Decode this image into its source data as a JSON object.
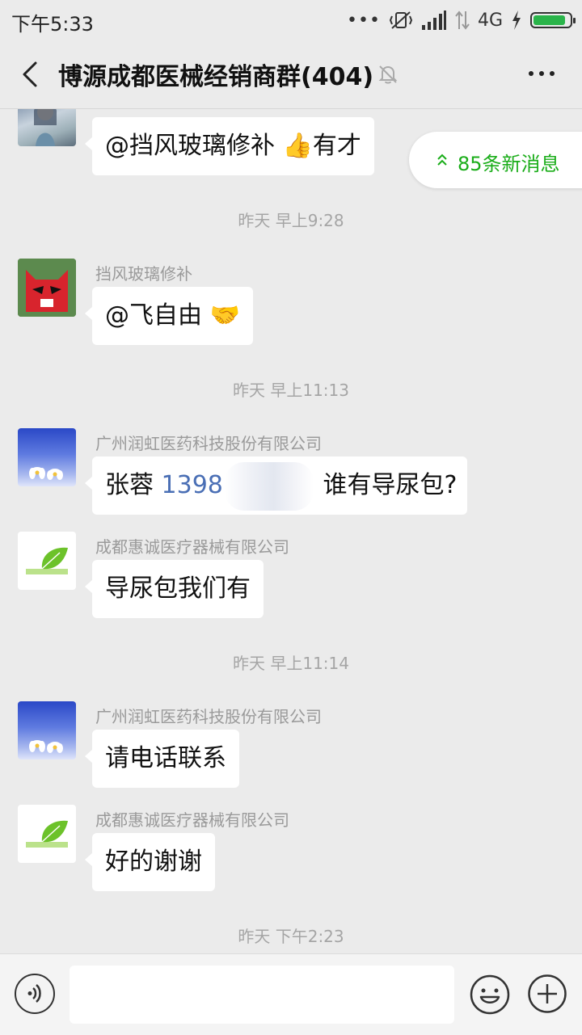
{
  "status_bar": {
    "time": "下午5:33",
    "dots": "•••",
    "network": "4G",
    "battery_level": 0.9
  },
  "header": {
    "title": "博源成都医械经销商群(404)",
    "back_icon": "chevron-left-icon",
    "mute_icon": "bell-muted-icon",
    "more_icon": "more-dots-icon"
  },
  "new_messages": {
    "label": "85条新消息",
    "icon": "double-chevron-up-icon"
  },
  "messages": [
    {
      "text": "@挡风玻璃修补 👍有才"
    },
    {
      "timestamp": "昨天 早上9:28"
    },
    {
      "sender": "挡风玻璃修补",
      "text": "@飞自由 🤝"
    },
    {
      "timestamp": "昨天 早上11:13"
    },
    {
      "sender": "广州润虹医药科技股份有限公司",
      "text_prefix": "张蓉 ",
      "phone": "1398",
      "text_suffix": " 谁有导尿包?"
    },
    {
      "sender": "成都惠诚医疗器械有限公司",
      "text": "导尿包我们有"
    },
    {
      "timestamp": "昨天 早上11:14"
    },
    {
      "sender": "广州润虹医药科技股份有限公司",
      "text": "请电话联系"
    },
    {
      "sender": "成都惠诚医疗器械有限公司",
      "text": "好的谢谢"
    },
    {
      "timestamp": "昨天 下午2:23"
    }
  ],
  "input_bar": {
    "voice_icon": "voice-icon",
    "emoji_icon": "emoji-icon",
    "plus_icon": "plus-icon",
    "placeholder": ""
  },
  "colors": {
    "accent_green": "#1aad19",
    "background": "#ebebeb",
    "phone_link": "#4a6fb5"
  }
}
